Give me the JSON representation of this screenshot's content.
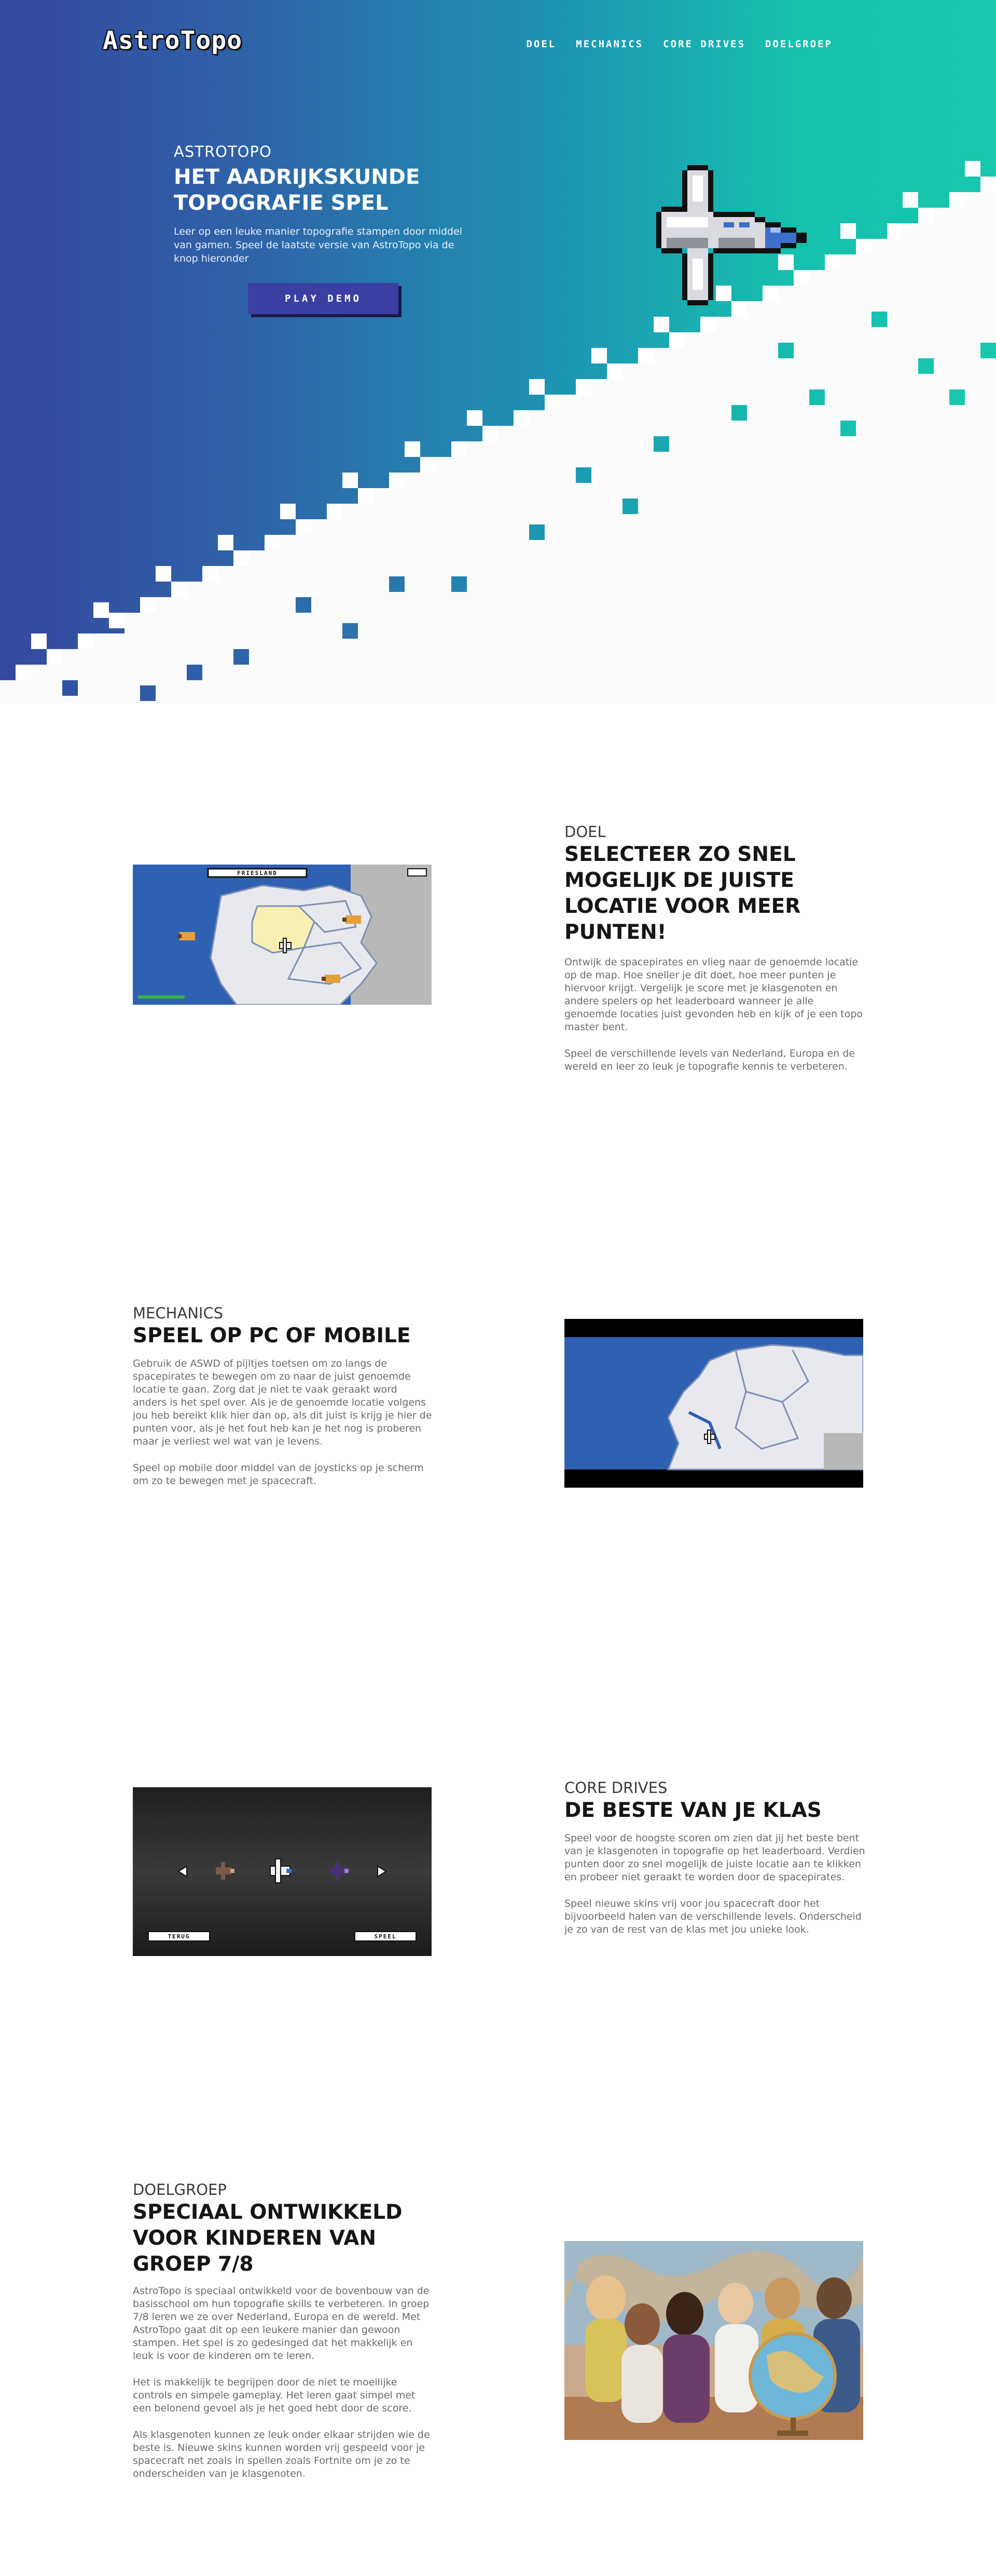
{
  "nav": {
    "logo": "AstroTopo",
    "links": [
      "DOEL",
      "MECHANICS",
      "CORE DRIVES",
      "DOELGROEP"
    ]
  },
  "hero": {
    "eyebrow": "ASTROTOPO",
    "title": "HET AADRIJKSKUNDE TOPOGRAFIE SPEL",
    "text": "Leer op een leuke manier topografie stampen door middel van gamen. Speel de laatste versie van AstroTopo via de knop hieronder",
    "button": "PLAY DEMO"
  },
  "doel": {
    "eyebrow": "DOEL",
    "title": "SELECTEER ZO SNEL MOGELIJK DE JUISTE LOCATIE VOOR MEER PUNTEN!",
    "p1": "Ontwijk de spacepirates en vlieg naar de genoemde locatie op de map. Hoe sneller je dit doet, hoe meer punten je hiervoor krijgt. Vergelijk je score met je klasgenoten en andere spelers op het leaderboard wanneer je alle genoemde locaties juist gevonden heb en kijk of je een topo master bent.",
    "p2": "Speel de verschillende levels van Nederland, Europa en de wereld en leer zo leuk je topografie kennis te verbeteren.",
    "map_label": "FRIESLAND"
  },
  "mechanics": {
    "eyebrow": "MECHANICS",
    "title": "SPEEL OP PC OF MOBILE",
    "p1": "Gebruik de ASWD of pijltjes toetsen om zo langs de spacepirates te bewegen om zo naar de juist genoemde locatie te gaan. Zorg dat je niet te vaak geraakt word anders is het spel over. Als je de genoemde locatie volgens jou heb bereikt klik hier dan op, als dit juist is krijg je hier de punten voor, als je het fout heb kan je het nog is proberen maar je verliest wel wat van je levens.",
    "p2": "Speel op mobile door middel van de joysticks op je scherm om zo te bewegen met je spacecraft."
  },
  "core": {
    "eyebrow": "CORE DRIVES",
    "title": "DE BESTE VAN JE KLAS",
    "p1": "Speel voor de hoogste scoren om zien dat jij het beste bent van je klasgenoten in topografie op het leaderboard. Verdien punten door zo snel mogelijk de juiste locatie aan te klikken en probeer niet geraakt te worden door de spacepirates.",
    "p2": "Speel nieuwe skins vrij voor jou spacecraft door het bijvoorbeeld halen van de verschillende levels. Onderscheid je zo van de rest van de klas met jou unieke look.",
    "btn_back": "TERUG",
    "btn_play": "SPEEL"
  },
  "doelgroep": {
    "eyebrow": "DOELGROEP",
    "title": "SPECIAAL ONTWIKKELD VOOR KINDEREN VAN GROEP 7/8",
    "p1": "AstroTopo is speciaal ontwikkeld voor de bovenbouw van de basisschool om hun topografie skills te verbeteren. In groep 7/8 leren we ze over Nederland, Europa en de wereld. Met AstroTopo gaat dit op een leukere manier dan gewoon stampen. Het spel is zo gedesinged dat het makkelijk en leuk is voor de kinderen om te leren.",
    "p2": "Het is makkelijk te begrijpen door de niet te moeilijke controls en simpele gameplay. Het leren gaat simpel met een belonend gevoel als je het goed hebt door de score.",
    "p3": "Als klasgenoten kunnen ze leuk onder elkaar strijden wie de beste is. Nieuwe skins kunnen worden vrij gespeeld voor je spacecraft net zoals in spellen zoals Fortnite om je zo te onderscheiden van je klasgenoten."
  },
  "colors": {
    "gradient_start": "#34489e",
    "gradient_end": "#17c7ae",
    "button": "#3b3fa1",
    "map_water": "#2e5fb0"
  }
}
